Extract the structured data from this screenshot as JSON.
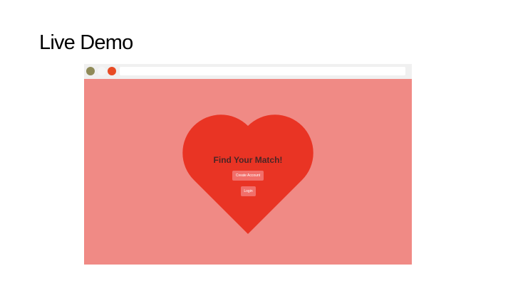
{
  "slide": {
    "title": "Live Demo"
  },
  "browser": {
    "window_buttons": [
      "olive-dot",
      "blank-dot",
      "red-dot"
    ],
    "address": ""
  },
  "app": {
    "heading": "Find Your Match!",
    "create_account_label": "Create Account",
    "login_label": "Login"
  },
  "colors": {
    "page_background": "#f08a85",
    "heart": "#e93424",
    "button": "#f16f6a",
    "heading_text": "#4a2626"
  }
}
